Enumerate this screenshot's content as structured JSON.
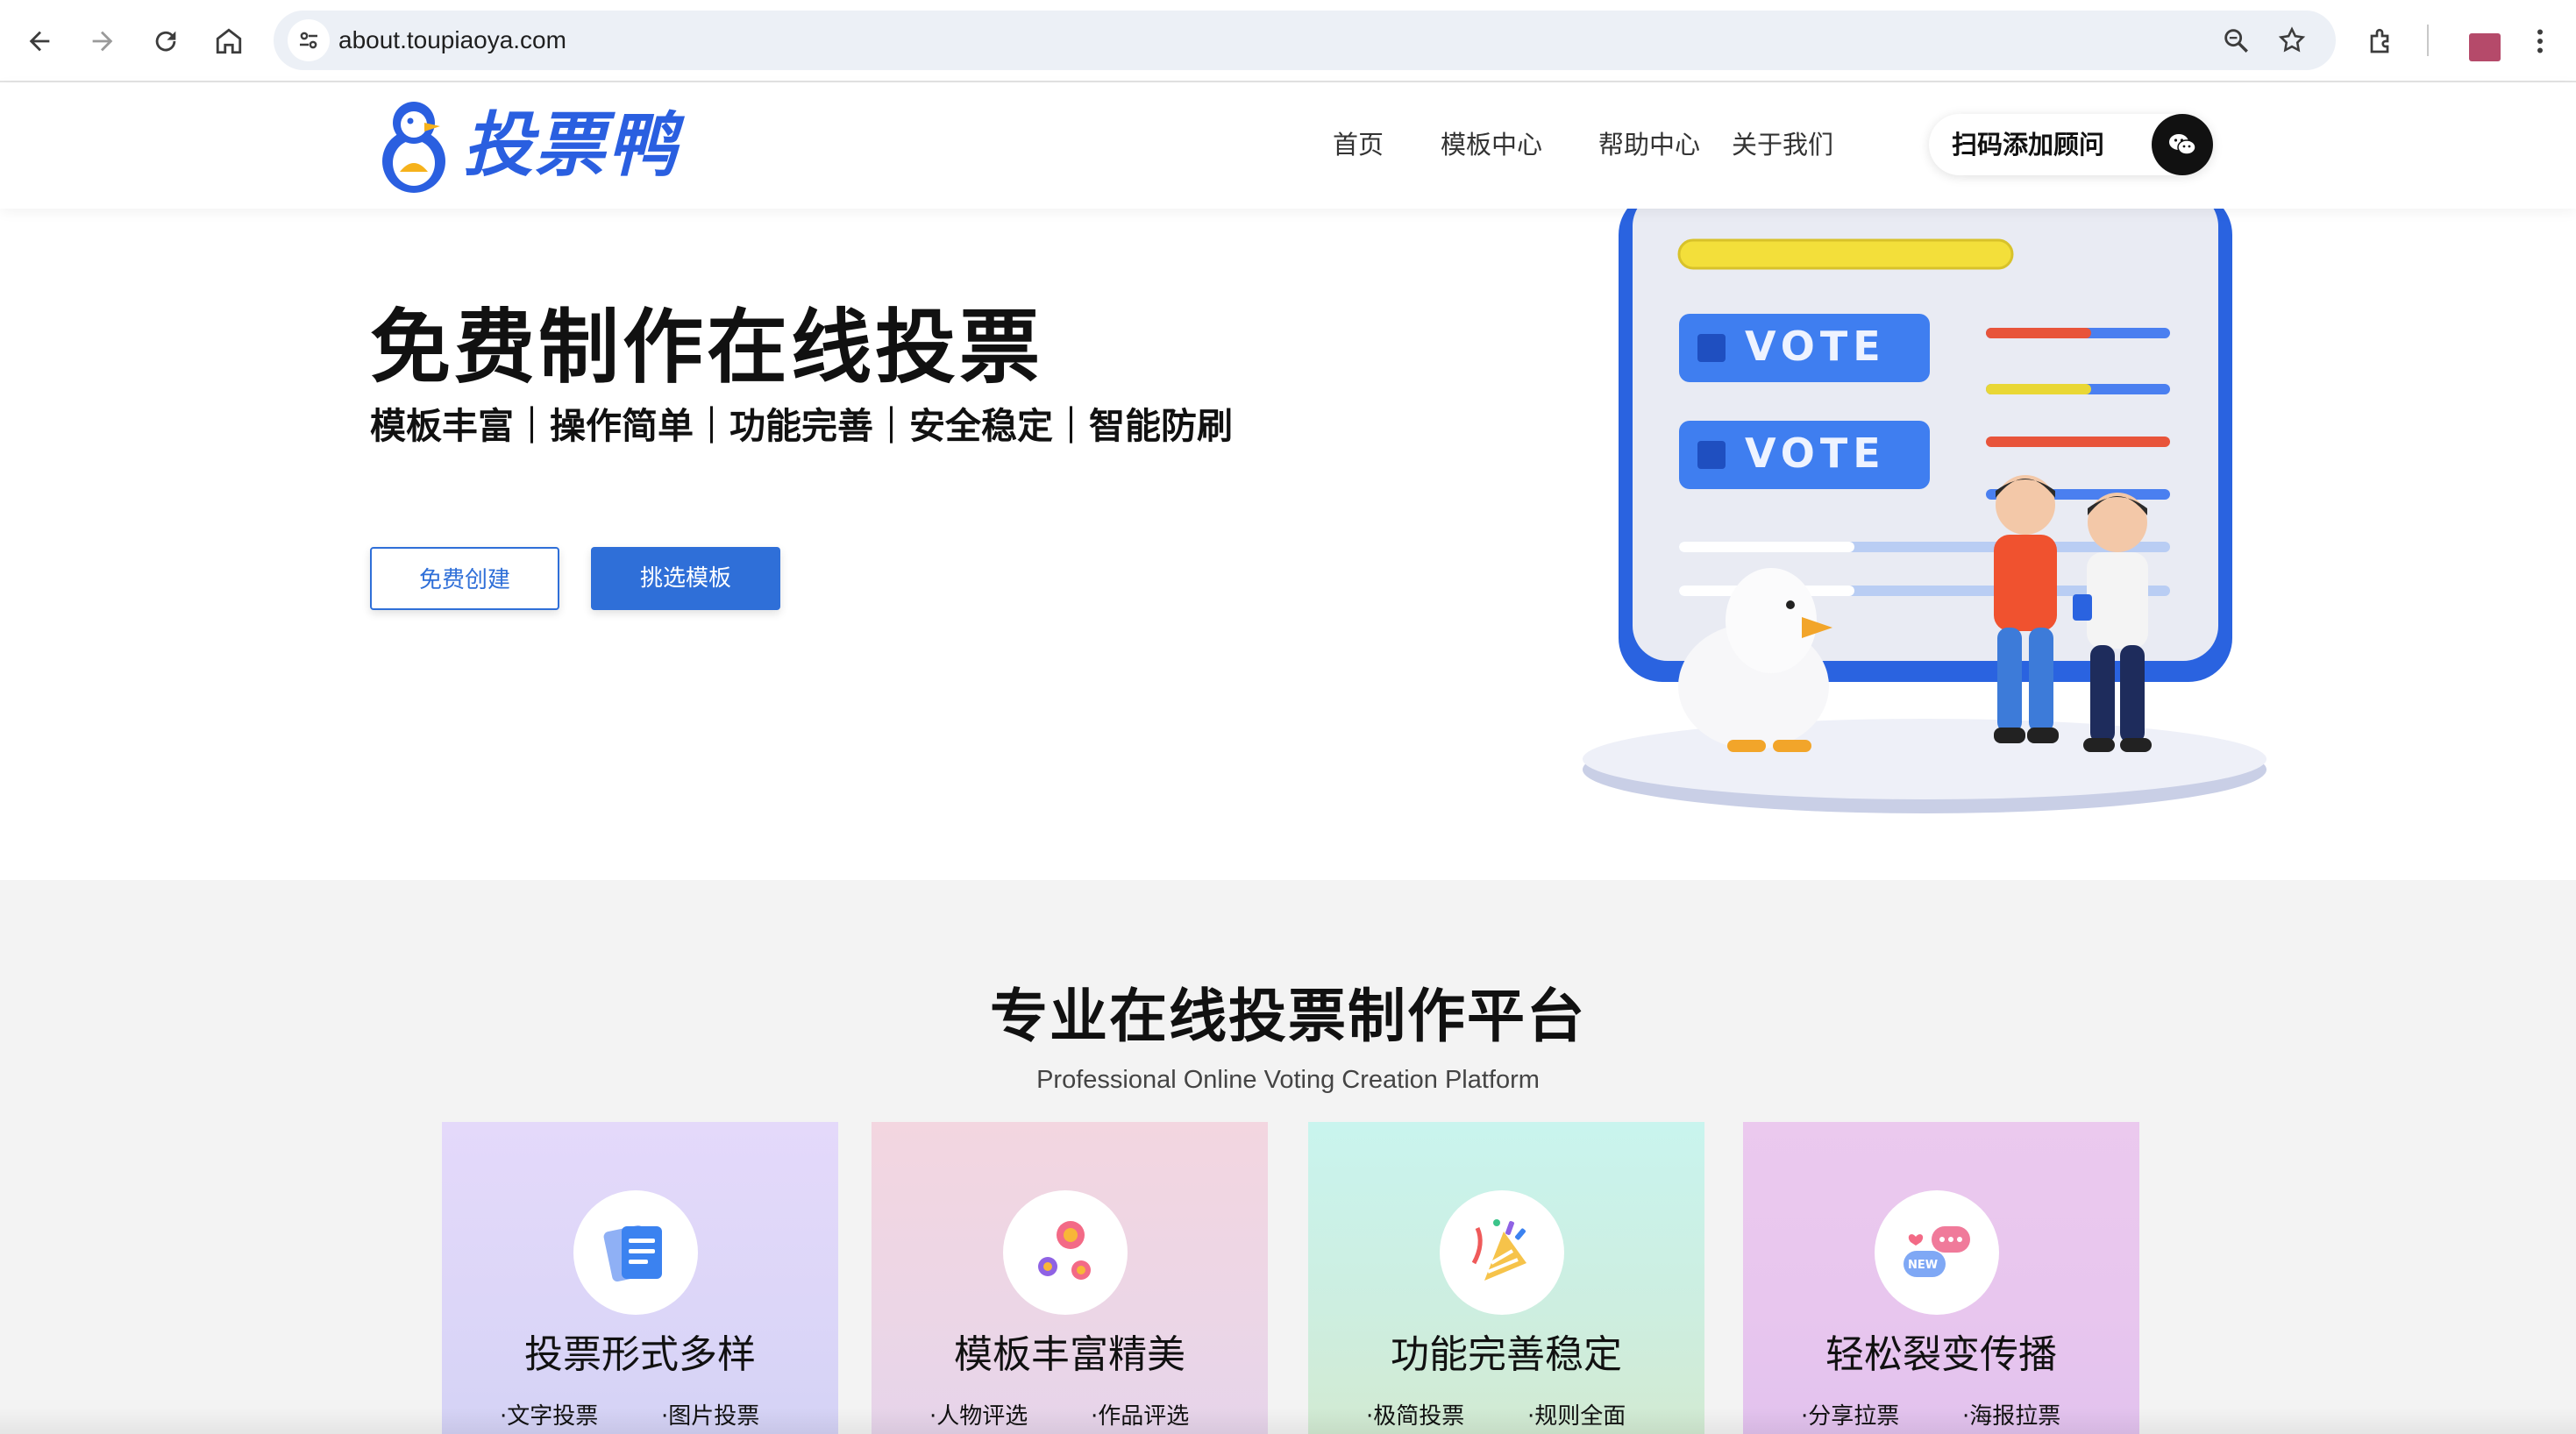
{
  "browser": {
    "url": "about.toupiaoya.com",
    "profile_color": "#b54a6a"
  },
  "header": {
    "logo_text": "投票鸭",
    "menu": [
      "首页",
      "模板中心",
      "帮助中心",
      "关于我们"
    ],
    "consult_label": "扫码添加顾问"
  },
  "hero": {
    "title": "免费制作在线投票",
    "subtitle": "模板丰富｜操作简单｜功能完善｜安全稳定｜智能防刷",
    "btn_create": "免费创建",
    "btn_templates": "挑选模板",
    "vote_label_1": "VOTE",
    "vote_label_2": "VOTE"
  },
  "features": {
    "title": "专业在线投票制作平台",
    "subtitle": "Professional Online Voting Creation Platform",
    "cards": [
      {
        "title": "投票形式多样",
        "tags": [
          "·文字投票",
          "·图片投票"
        ],
        "icon": "document-icon"
      },
      {
        "title": "模板丰富精美",
        "tags": [
          "·人物评选",
          "·作品评选"
        ],
        "icon": "flower-icon"
      },
      {
        "title": "功能完善稳定",
        "tags": [
          "·极简投票",
          "·规则全面"
        ],
        "icon": "party-popper-icon"
      },
      {
        "title": "轻松裂变传播",
        "tags": [
          "·分享拉票",
          "·海报拉票"
        ],
        "icon": "chat-bubble-icon"
      }
    ]
  },
  "colors": {
    "brand_blue": "#2f6fd8",
    "logo_blue": "#2a5fe0"
  }
}
